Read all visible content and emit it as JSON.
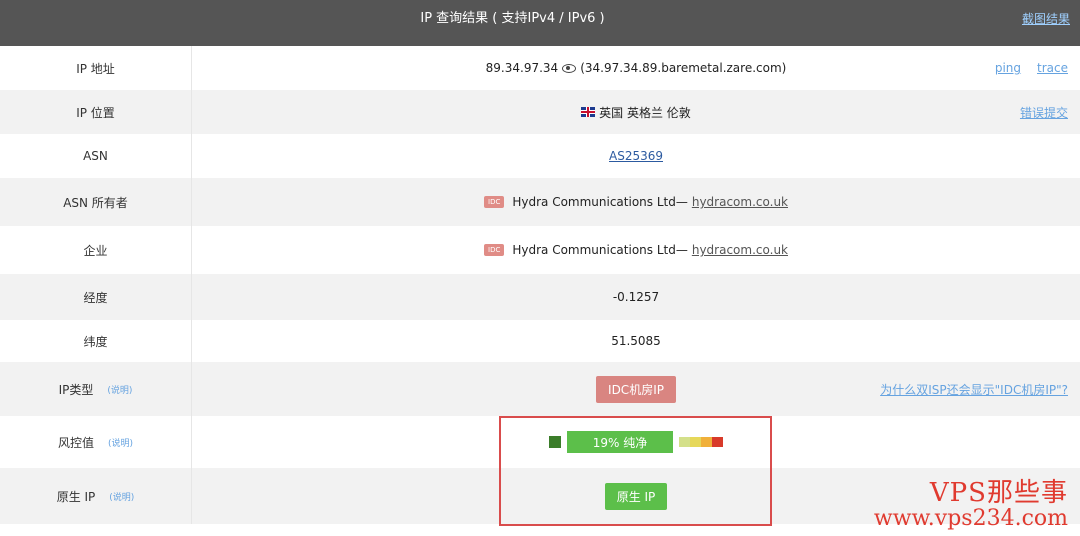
{
  "header": {
    "title": "IP 查询结果 ( 支持IPv4 / IPv6 )",
    "screenshot_link": "截图结果"
  },
  "rows": {
    "ip": {
      "label": "IP 地址",
      "ip": "89.34.97.34",
      "rdns": "(34.97.34.89.baremetal.zare.com)",
      "ping": "ping",
      "trace": "trace"
    },
    "location": {
      "label": "IP 位置",
      "value": "英国 英格兰 伦敦",
      "report": "错误提交"
    },
    "asn": {
      "label": "ASN",
      "value": "AS25369"
    },
    "asn_owner": {
      "label": "ASN 所有者",
      "tag": "IDC",
      "name": "Hydra Communications Ltd—",
      "domain": "hydracom.co.uk"
    },
    "company": {
      "label": "企业",
      "tag": "IDC",
      "name": "Hydra Communications Ltd—",
      "domain": "hydracom.co.uk"
    },
    "longitude": {
      "label": "经度",
      "value": "-0.1257"
    },
    "latitude": {
      "label": "纬度",
      "value": "51.5085"
    },
    "ip_type": {
      "label": "IP类型",
      "help": "(说明)",
      "value": "IDC机房IP",
      "note": "为什么双ISP还会显示\"IDC机房IP\"?"
    },
    "risk": {
      "label": "风控值",
      "help": "(说明)",
      "value": "19%  纯净",
      "score": 0.19
    },
    "native": {
      "label": "原生 IP",
      "help": "(说明)",
      "value": "原生 IP"
    }
  },
  "watermark": {
    "line1": "VPS那些事",
    "line2": "www.vps234.com"
  },
  "colors": {
    "header": "#555555",
    "risk_green": "#5cbf4a",
    "idc_red": "#d98581",
    "highlight": "#d94c4c"
  }
}
